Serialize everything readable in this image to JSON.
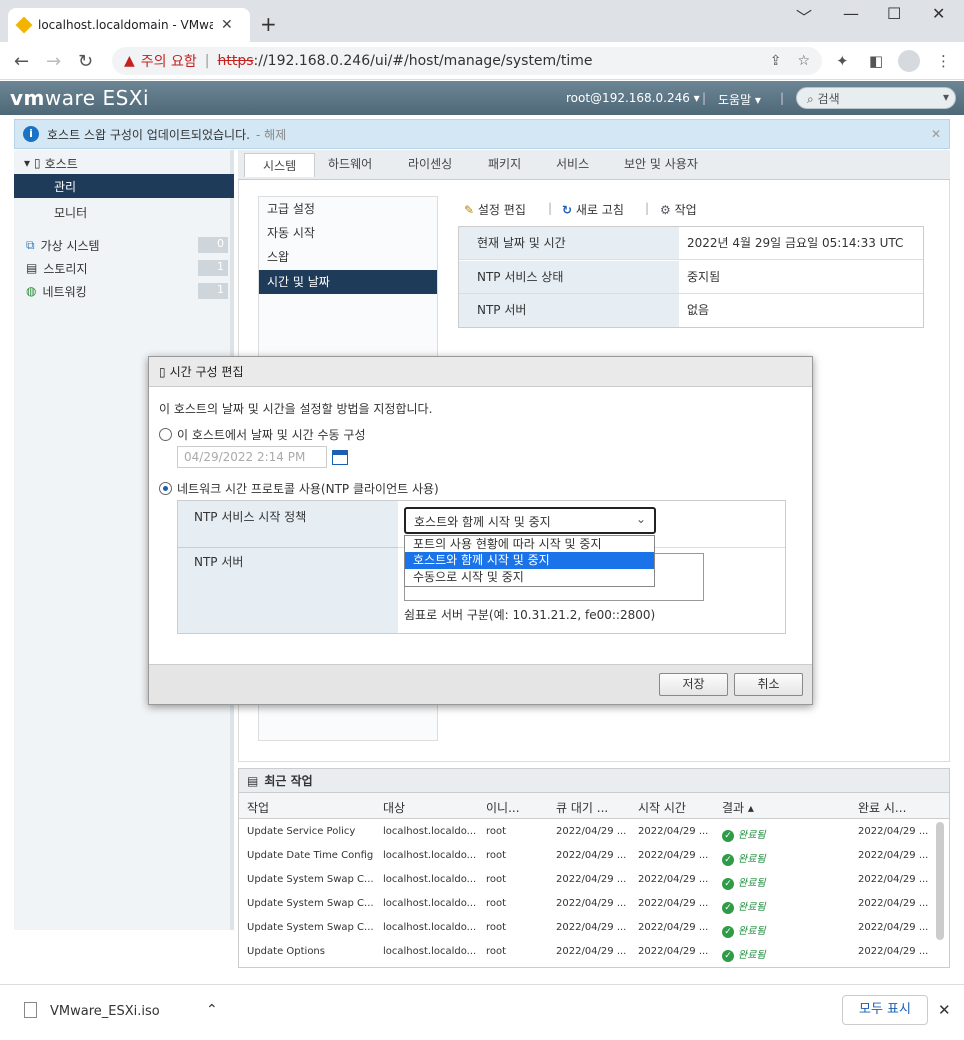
{
  "browser": {
    "tab_title": "localhost.localdomain - VMware",
    "new_tab": "+",
    "window_controls": [
      "﹀",
      "—",
      "☐",
      "✕"
    ],
    "security_warning": "주의 요함",
    "url_scheme": "https",
    "url_rest": "://192.168.0.246/ui/#/host/manage/system/time"
  },
  "esxi_header": {
    "logo_vm": "vm",
    "logo_ware": "ware",
    "logo_esxi": " ESXi",
    "user": "root@192.168.0.246 ▾",
    "help": "도움말 ▾",
    "search_placeholder": "검색"
  },
  "notification": {
    "text": "호스트 스왑 구성이 업데이트되었습니다.",
    "dismiss": "- 해제"
  },
  "navigator": {
    "host": "호스트",
    "manage": "관리",
    "monitor": "모니터",
    "items": [
      {
        "label": "가상 시스템",
        "count": "0"
      },
      {
        "label": "스토리지",
        "count": "1"
      },
      {
        "label": "네트워킹",
        "count": "1"
      }
    ]
  },
  "main_tabs": [
    "시스템",
    "하드웨어",
    "라이센싱",
    "패키지",
    "서비스",
    "보안 및 사용자"
  ],
  "sub_menu": [
    "고급 설정",
    "자동 시작",
    "스왑",
    "시간 및 날짜"
  ],
  "toolbar": {
    "edit": "설정 편집",
    "refresh": "새로 고침",
    "actions": "작업"
  },
  "time_info": [
    {
      "key": "현재 날짜 및 시간",
      "value": "2022년 4월 29일 금요일 05:14:33 UTC"
    },
    {
      "key": "NTP 서비스 상태",
      "value": "중지됨"
    },
    {
      "key": "NTP 서버",
      "value": "없음"
    }
  ],
  "dialog": {
    "title": "시간 구성 편집",
    "description": "이 호스트의 날짜 및 시간을 설정할 방법을 지정합니다.",
    "manual_option": "이 호스트에서 날짜 및 시간 수동 구성",
    "manual_date": "04/29/2022 2:14 PM",
    "ntp_option": "네트워크 시간 프로토콜 사용(NTP 클라이언트 사용)",
    "ntp_policy_label": "NTP 서비스 시작 정책",
    "ntp_policy_value": "호스트와 함께 시작 및 중지",
    "ntp_policy_options": [
      "포트의 사용 현황에 따라 시작 및 중지",
      "호스트와 함께 시작 및 중지",
      "수동으로 시작 및 중지"
    ],
    "ntp_server_label": "NTP 서버",
    "ntp_server_hint": "쉼표로 서버 구분(예: 10.31.21.2, fe00::2800)",
    "save": "저장",
    "cancel": "취소"
  },
  "recent_tasks": {
    "title": "최근 작업",
    "columns": [
      "작업",
      "대상",
      "이니...",
      "큐 대기 ...",
      "시작 시간",
      "결과 ▴",
      "완료 시..."
    ],
    "rows": [
      [
        "Update Service Policy",
        "localhost.localdo...",
        "root",
        "2022/04/29 ...",
        "2022/04/29 ...",
        "완료됨",
        "2022/04/29 ..."
      ],
      [
        "Update Date Time Config",
        "localhost.localdo...",
        "root",
        "2022/04/29 ...",
        "2022/04/29 ...",
        "완료됨",
        "2022/04/29 ..."
      ],
      [
        "Update System Swap C...",
        "localhost.localdo...",
        "root",
        "2022/04/29 ...",
        "2022/04/29 ...",
        "완료됨",
        "2022/04/29 ..."
      ],
      [
        "Update System Swap C...",
        "localhost.localdo...",
        "root",
        "2022/04/29 ...",
        "2022/04/29 ...",
        "완료됨",
        "2022/04/29 ..."
      ],
      [
        "Update System Swap C...",
        "localhost.localdo...",
        "root",
        "2022/04/29 ...",
        "2022/04/29 ...",
        "완료됨",
        "2022/04/29 ..."
      ],
      [
        "Update Options",
        "localhost.localdo...",
        "root",
        "2022/04/29 ...",
        "2022/04/29 ...",
        "완료됨",
        "2022/04/29 ..."
      ]
    ]
  },
  "download_bar": {
    "file": "VMware_ESXi.iso",
    "show_all": "모두 표시"
  },
  "colors": {
    "nav_selected": "#1e3b59",
    "header": "#5f7888",
    "dropdown_highlight": "#1a73e8"
  }
}
